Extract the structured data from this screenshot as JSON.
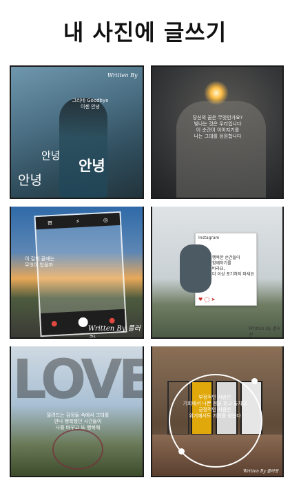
{
  "header": {
    "title": "내 사진에 글쓰기"
  },
  "tiles": {
    "t1": {
      "watermark": "Written By",
      "caption": "그리네 Goodbye\n이젠 안녕",
      "word1": "안녕",
      "word2": "안녕",
      "word3": "안녕"
    },
    "t2": {
      "caption": "당신의 꿈은 무엇인가요?\n빛나는 것은 우리입니다\n이 순간이 이어지기를\n나는 그대를 응원합니다"
    },
    "t3": {
      "caption": "이 길의 끝에는\n무엇이 있을까",
      "watermark": "Written By 플러랑"
    },
    "t4": {
      "app_name": "Instagram",
      "caption": "행복한 순간들이\n함께하기를\n바라요,\n더 이상 포기하지 마세요",
      "watermark": "Written By 플러랑"
    },
    "t5": {
      "big_word": "LOVE",
      "caption": "밀려드는 감정들 속에서 그대를\n만나 행복했던 시간들이\n나를 바꾸고 또 행복해"
    },
    "t6": {
      "caption": "부정적인 사람은\n기회에서 나쁜 점을 찾고 놓치고\n긍정적인 사람은\n위기에서도 기회를 찾는다",
      "watermark": "Written By 플러랑"
    }
  }
}
